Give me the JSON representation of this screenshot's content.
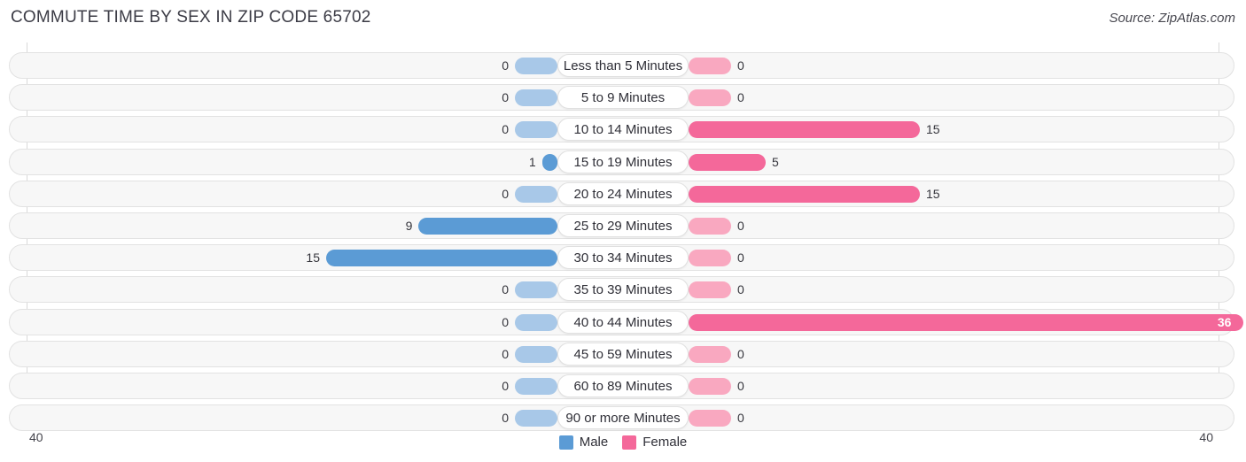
{
  "title": "COMMUTE TIME BY SEX IN ZIP CODE 65702",
  "source": "Source: ZipAtlas.com",
  "axis": {
    "left": "40",
    "right": "40"
  },
  "legend": [
    {
      "label": "Male",
      "color": "#5B9BD5",
      "icon": "male-color-swatch"
    },
    {
      "label": "Female",
      "color": "#F4689A",
      "icon": "female-color-swatch"
    }
  ],
  "colors": {
    "male_strong": "#5B9BD5",
    "male_pale": "#A8C8E8",
    "female_strong": "#F4689A",
    "female_pale": "#F9A8C0",
    "track_fill": "#f7f7f7",
    "track_border": "#e2e2e2",
    "gridline": "#d9d9d9"
  },
  "chart_data": {
    "type": "bar",
    "title": "COMMUTE TIME BY SEX IN ZIP CODE 65702",
    "orientation": "horizontal-diverging",
    "xlabel": "",
    "ylabel": "",
    "xlim": [
      40,
      40
    ],
    "grid": false,
    "legend_position": "bottom",
    "categories": [
      "Less than 5 Minutes",
      "5 to 9 Minutes",
      "10 to 14 Minutes",
      "15 to 19 Minutes",
      "20 to 24 Minutes",
      "25 to 29 Minutes",
      "30 to 34 Minutes",
      "35 to 39 Minutes",
      "40 to 44 Minutes",
      "45 to 59 Minutes",
      "60 to 89 Minutes",
      "90 or more Minutes"
    ],
    "series": [
      {
        "name": "Male",
        "values": [
          0,
          0,
          0,
          1,
          0,
          9,
          15,
          0,
          0,
          0,
          0,
          0
        ]
      },
      {
        "name": "Female",
        "values": [
          0,
          0,
          15,
          5,
          15,
          0,
          0,
          0,
          36,
          0,
          0,
          0
        ]
      }
    ]
  },
  "rows": [
    {
      "label": "Less than 5 Minutes",
      "male": "0",
      "female": "0"
    },
    {
      "label": "5 to 9 Minutes",
      "male": "0",
      "female": "0"
    },
    {
      "label": "10 to 14 Minutes",
      "male": "0",
      "female": "15"
    },
    {
      "label": "15 to 19 Minutes",
      "male": "1",
      "female": "5"
    },
    {
      "label": "20 to 24 Minutes",
      "male": "0",
      "female": "15"
    },
    {
      "label": "25 to 29 Minutes",
      "male": "9",
      "female": "0"
    },
    {
      "label": "30 to 34 Minutes",
      "male": "15",
      "female": "0"
    },
    {
      "label": "35 to 39 Minutes",
      "male": "0",
      "female": "0"
    },
    {
      "label": "40 to 44 Minutes",
      "male": "0",
      "female": "36"
    },
    {
      "label": "45 to 59 Minutes",
      "male": "0",
      "female": "0"
    },
    {
      "label": "60 to 89 Minutes",
      "male": "0",
      "female": "0"
    },
    {
      "label": "90 or more Minutes",
      "male": "0",
      "female": "0"
    }
  ]
}
